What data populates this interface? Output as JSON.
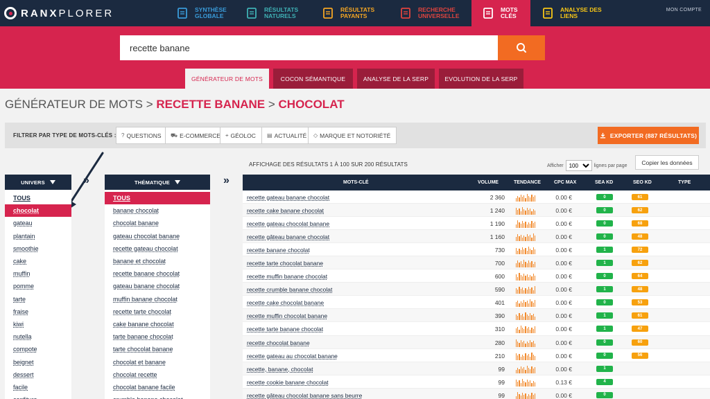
{
  "brand": {
    "name_a": "RANX",
    "name_b": "PLORER"
  },
  "nav": [
    {
      "label": "SYNTHÈSE GLOBALE",
      "icon": "document-icon",
      "color": "#3a9bd9"
    },
    {
      "label": "RÉSULTATS NATURELS",
      "icon": "list-icon",
      "color": "#3fb1b5"
    },
    {
      "label": "RÉSULTATS PAYANTS",
      "icon": "coin-icon",
      "color": "#f5a623"
    },
    {
      "label": "RECHERCHE UNIVERSELLE",
      "icon": "grid-icon",
      "color": "#e0443e"
    },
    {
      "label": "MOTS CLÉS",
      "icon": "key-icon",
      "color": "#ffffff"
    },
    {
      "label": "ANALYSE DES LIENS",
      "icon": "link-icon",
      "color": "#f7c616"
    }
  ],
  "account": "MON COMPTE",
  "search": {
    "value": "recette banane",
    "button_icon": "search-icon"
  },
  "tabs": [
    "GÉNÉRATEUR DE MOTS",
    "COCON SÉMANTIQUE",
    "ANALYSE DE LA SERP",
    "EVOLUTION DE LA SERP"
  ],
  "breadcrumb": {
    "root": "GÉNÉRATEUR DE MOTS",
    "sep": " > ",
    "level1": "RECETTE BANANE",
    "level2": "CHOCOLAT"
  },
  "filter": {
    "title": "FILTRER PAR TYPE DE MOTS-CLÉS :",
    "chips": [
      {
        "icon": "question-icon",
        "glyph": "?",
        "label": "QUESTIONS"
      },
      {
        "icon": "cart-icon",
        "glyph": "⛟",
        "label": "E-COMMERCE"
      },
      {
        "icon": "location-icon",
        "glyph": "⌖",
        "label": "GÉOLOC"
      },
      {
        "icon": "news-icon",
        "glyph": "▤",
        "label": "ACTUALITÉ"
      },
      {
        "icon": "tag-icon",
        "glyph": "◇",
        "label": "MARQUE ET NOTORIÉTÉ"
      }
    ],
    "export_label": "EXPORTER (887 RÉSULTATS)"
  },
  "univers": {
    "header": "UNIVERS",
    "items": [
      "TOUS",
      "chocolat",
      "gateau",
      "plantain",
      "smoothie",
      "cake",
      "muffin",
      "pomme",
      "tarte",
      "fraise",
      "kiwi",
      "nutella",
      "compote",
      "beignet",
      "dessert",
      "facile",
      "confiture"
    ],
    "selected_index": 1
  },
  "thematique": {
    "header": "THÉMATIQUE",
    "items": [
      "TOUS",
      "banane chocolat",
      "chocolat banane",
      "gateau chocolat banane",
      "recette gateau chocolat",
      "banane et chocolat",
      "recette banane chocolat",
      "gateau banane chocolat",
      "muffin banane chocolat",
      "recette tarte chocolat",
      "cake banane chocolat",
      "tarte banane chocolat",
      "tarte chocolat banane",
      "chocolat et banane",
      "chocolat recette",
      "chocolat banane facile",
      "crumble banane chocolat"
    ],
    "selected_index": 0
  },
  "results": {
    "info": "AFFICHAGE DES RÉSULTATS 1 À 100 SUR 200 RÉSULTATS",
    "show_label": "Afficher",
    "per_page": "100",
    "per_page_label": "lignes par page",
    "copy_label": "Copier les données",
    "columns": {
      "keyword": "MOTS-CLÉ",
      "volume": "VOLUME",
      "trend": "TENDANCE",
      "cpc": "CPC MAX",
      "sea": "SEA KD",
      "seo": "SEO KD",
      "type": "TYPE"
    },
    "rows": [
      {
        "kw": "recette gateau banane chocolat",
        "vol": "2 360",
        "cpc": "0.00 €",
        "sea": "0",
        "seo": "61"
      },
      {
        "kw": "recette cake banane chocolat",
        "vol": "1 240",
        "cpc": "0.00 €",
        "sea": "0",
        "seo": "62"
      },
      {
        "kw": "recette gateau chocolat banane",
        "vol": "1 190",
        "cpc": "0.00 €",
        "sea": "0",
        "seo": "68"
      },
      {
        "kw": "recette gâteau banane chocolat",
        "vol": "1 160",
        "cpc": "0.00 €",
        "sea": "0",
        "seo": "48"
      },
      {
        "kw": "recette banane chocolat",
        "vol": "730",
        "cpc": "0.00 €",
        "sea": "1",
        "seo": "72"
      },
      {
        "kw": "recette tarte chocolat banane",
        "vol": "700",
        "cpc": "0.00 €",
        "sea": "1",
        "seo": "62"
      },
      {
        "kw": "recette muffin banane chocolat",
        "vol": "600",
        "cpc": "0.00 €",
        "sea": "0",
        "seo": "64"
      },
      {
        "kw": "recette crumble banane chocolat",
        "vol": "590",
        "cpc": "0.00 €",
        "sea": "1",
        "seo": "48"
      },
      {
        "kw": "recette cake chocolat banane",
        "vol": "401",
        "cpc": "0.00 €",
        "sea": "0",
        "seo": "53"
      },
      {
        "kw": "recette muffin chocolat banane",
        "vol": "390",
        "cpc": "0.00 €",
        "sea": "1",
        "seo": "61"
      },
      {
        "kw": "recette tarte banane chocolat",
        "vol": "310",
        "cpc": "0.00 €",
        "sea": "1",
        "seo": "47"
      },
      {
        "kw": "recette chocolat banane",
        "vol": "280",
        "cpc": "0.00 €",
        "sea": "0",
        "seo": "60"
      },
      {
        "kw": "recette gateau au chocolat banane",
        "vol": "210",
        "cpc": "0.00 €",
        "sea": "0",
        "seo": "56"
      },
      {
        "kw": "recette, banane, chocolat",
        "vol": "99",
        "cpc": "0.00 €",
        "sea": "1",
        "seo": ""
      },
      {
        "kw": "recette cookie banane chocolat",
        "vol": "99",
        "cpc": "0.13 €",
        "sea": "4",
        "seo": ""
      },
      {
        "kw": "recette gâteau chocolat banane sans beurre",
        "vol": "99",
        "cpc": "0.00 €",
        "sea": "0",
        "seo": ""
      }
    ]
  },
  "colors": {
    "navy": "#1b2a40",
    "crimson": "#d6244e",
    "orange": "#f26b22",
    "green": "#21b34a",
    "amber": "#f7a10e"
  }
}
